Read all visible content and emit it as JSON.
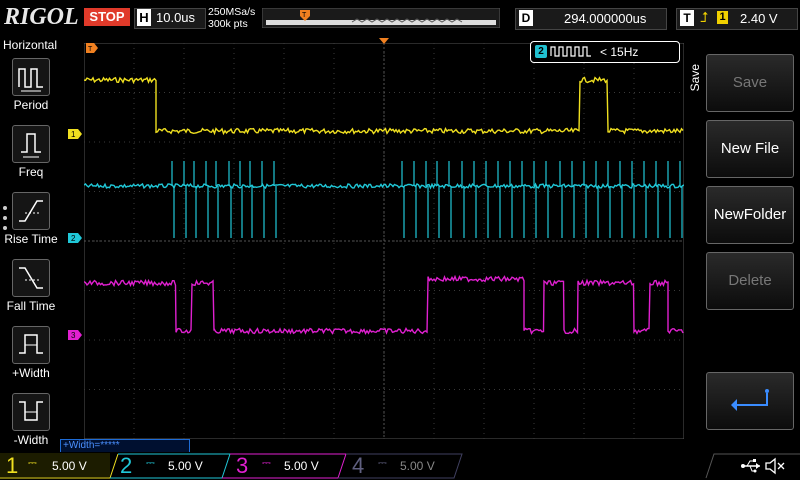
{
  "brand": "RIGOL",
  "run_state": "STOP",
  "horizontal": {
    "letter": "H",
    "timebase": "10.0us",
    "sample_rate": "250MSa/s",
    "points": "300k pts"
  },
  "delay": {
    "letter": "D",
    "value": "294.000000us"
  },
  "trigger": {
    "letter": "T",
    "source": "1",
    "level": "2.40 V",
    "color": "#f0d000"
  },
  "left_menu": {
    "title": "Horizontal",
    "items": [
      {
        "label": "Period",
        "icon": "period-icon"
      },
      {
        "label": "Freq",
        "icon": "freq-icon"
      },
      {
        "label": "Rise Time",
        "icon": "rise-time-icon"
      },
      {
        "label": "Fall Time",
        "icon": "fall-time-icon"
      },
      {
        "label": "+Width",
        "icon": "positive-width-icon"
      },
      {
        "label": "-Width",
        "icon": "negative-width-icon"
      }
    ]
  },
  "measurement_bar": "+Width=*****",
  "signal_info": {
    "channel": "2",
    "text": "< 15Hz"
  },
  "right_menu": {
    "section": "Save",
    "buttons": [
      {
        "label": "Save",
        "enabled": false
      },
      {
        "label": "New File",
        "enabled": true
      },
      {
        "label": "NewFolder",
        "enabled": true
      },
      {
        "label": "Delete",
        "enabled": false
      }
    ],
    "return_icon": "return-arrow-icon"
  },
  "channels": [
    {
      "num": "1",
      "scale": "5.00 V",
      "color": "#f0e020",
      "active": true
    },
    {
      "num": "2",
      "scale": "5.00 V",
      "color": "#20c8d8",
      "active": true
    },
    {
      "num": "3",
      "scale": "5.00 V",
      "color": "#e020d0",
      "active": true
    },
    {
      "num": "4",
      "scale": "5.00 V",
      "color": "#606080",
      "active": false
    }
  ],
  "status_icons": [
    "usb-icon",
    "speaker-muted-icon"
  ],
  "colors": {
    "stop_bg": "#e03a2a",
    "grid": "#3a3a3a",
    "ch1": "#f0e020",
    "ch2": "#20c8d8",
    "ch3": "#e020d0"
  }
}
